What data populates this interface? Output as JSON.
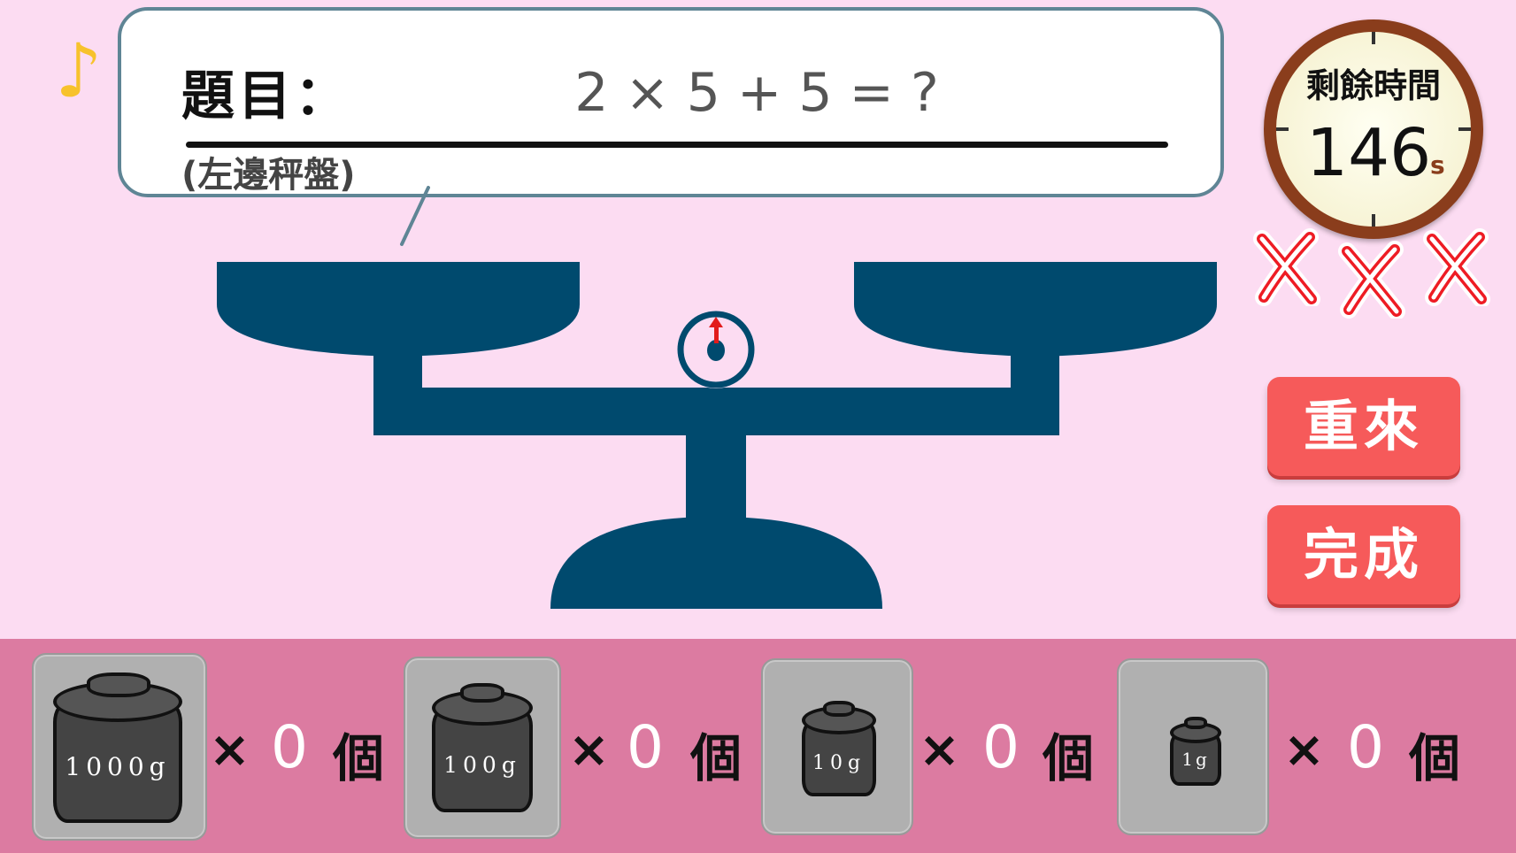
{
  "question": {
    "label": "題目：",
    "expression": "2 × 5 + 5 = ?",
    "hint": "(左邊秤盤)"
  },
  "audio": {
    "icon": "music-note-icon"
  },
  "timer": {
    "label": "剩餘時間",
    "value": "146",
    "unit": "s"
  },
  "lives": {
    "icon": "red-x-icon",
    "count": 3
  },
  "buttons": {
    "reset": "重來",
    "done": "完成"
  },
  "weights": [
    {
      "label": "1000g",
      "times": "×",
      "count": "0",
      "unit": "個"
    },
    {
      "label": "100g",
      "times": "×",
      "count": "0",
      "unit": "個"
    },
    {
      "label": "10g",
      "times": "×",
      "count": "0",
      "unit": "個"
    },
    {
      "label": "1g",
      "times": "×",
      "count": "0",
      "unit": "個"
    }
  ],
  "colors": {
    "background": "#fcdcf2",
    "scale": "#004a6e",
    "tray": "#dc7ba1",
    "button": "#f65a5a",
    "indicator": "#e21b1b"
  }
}
